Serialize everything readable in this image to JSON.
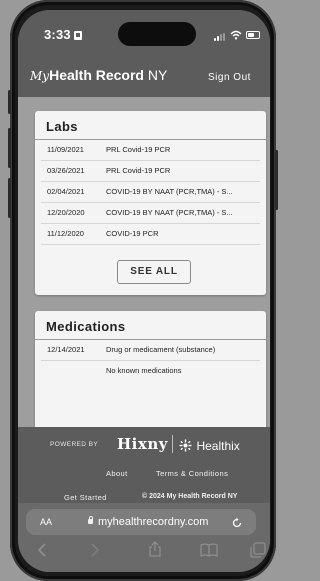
{
  "status_bar": {
    "time": "3:33"
  },
  "header": {
    "logo_my": "My",
    "logo_health_record": "Health Record",
    "logo_ny": " NY",
    "sign_out": "Sign Out"
  },
  "labs": {
    "title": "Labs",
    "rows": [
      {
        "date": "11/09/2021",
        "desc": "PRL Covid-19 PCR"
      },
      {
        "date": "03/26/2021",
        "desc": "PRL Covid-19 PCR"
      },
      {
        "date": "02/04/2021",
        "desc": "COVID-19 BY NAAT (PCR,TMA) - S..."
      },
      {
        "date": "12/20/2020",
        "desc": "COVID-19 BY NAAT (PCR,TMA) - S..."
      },
      {
        "date": "11/12/2020",
        "desc": "COVID-19 PCR"
      }
    ],
    "see_all": "SEE ALL"
  },
  "medications": {
    "title": "Medications",
    "rows": [
      {
        "date": "12/14/2021",
        "desc": "Drug or medicament (substance)"
      },
      {
        "date": "",
        "desc": "No known medications"
      }
    ]
  },
  "footer": {
    "powered_by": "POWERED BY",
    "hixny": "Hixny",
    "healthix": "Healthix",
    "about": "About",
    "terms": "Terms & Conditions",
    "get_started": "Get Started",
    "copyright": "© 2024 My Health Record NY"
  },
  "browser": {
    "text_size": "AA",
    "url": "myhealthrecordny.com"
  },
  "icons": {
    "reload": "reload-icon",
    "back": "back-icon",
    "forward": "forward-icon",
    "share": "share-icon",
    "bookmarks": "bookmarks-icon",
    "tabs": "tabs-icon"
  }
}
